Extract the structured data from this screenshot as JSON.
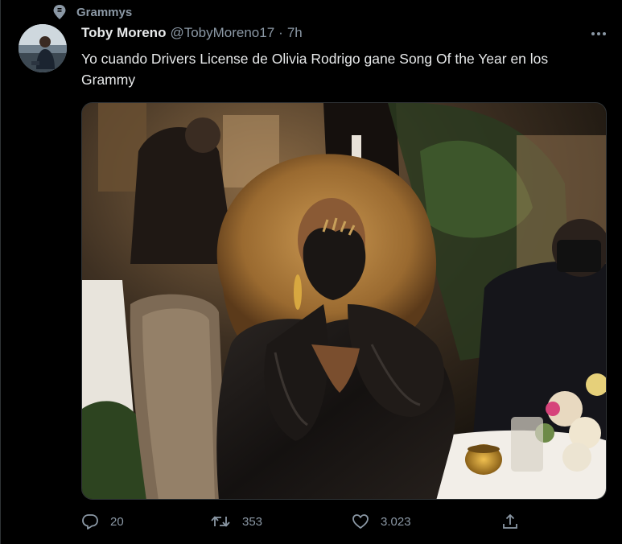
{
  "context": {
    "label": "Grammys",
    "icon": "topic-pin-icon"
  },
  "author": {
    "display_name": "Toby Moreno",
    "handle": "@TobyMoreno17",
    "separator": "·",
    "time": "7h",
    "avatar_icon": "avatar-photo"
  },
  "more_icon": "more-options-icon",
  "tweet_text": "Yo cuando Drivers License de Olivia Rodrigo gane Song Of the Year en los Grammy",
  "media": {
    "kind": "photo"
  },
  "actions": {
    "reply": {
      "icon": "reply-icon",
      "count": "20"
    },
    "retweet": {
      "icon": "retweet-icon",
      "count": "353"
    },
    "like": {
      "icon": "heart-icon",
      "count": "3.023"
    },
    "share": {
      "icon": "share-icon"
    }
  },
  "colors": {
    "background": "#000000",
    "primary_text": "#e7e9ea",
    "secondary_text": "#8b98a5",
    "border": "#2f3336"
  }
}
